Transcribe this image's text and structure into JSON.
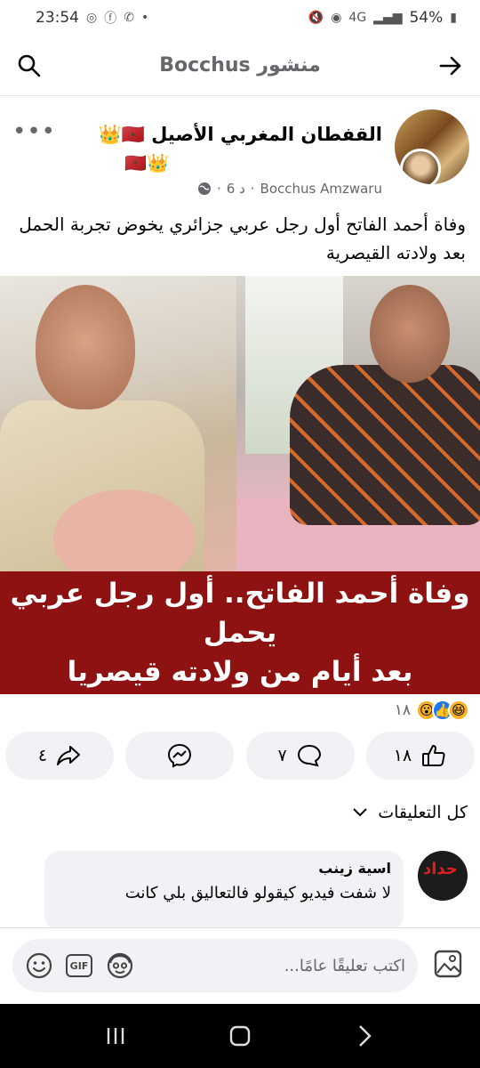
{
  "status_bar": {
    "battery": "54%",
    "time": "23:54",
    "network": "4G"
  },
  "topbar": {
    "title": "منشور Bocchus"
  },
  "post": {
    "page_name": "القفطان المغربي الأصيل",
    "flag_icons": "🇲🇦👑",
    "author": "Bocchus Amzwaru",
    "time": "6 د",
    "more_label": "•••",
    "text": "وفاة أحمد الفاتح أول رجل عربي جزائري يخوض تجربة الحمل بعد ولادته القيصرية",
    "image_caption": {
      "line1": "وفاة أحمد الفاتح.. أول رجل عربي يحمل",
      "line2": "بعد أيام من ولادته قيصريا"
    },
    "reactions": {
      "count": "١٨",
      "types": [
        "haha",
        "like",
        "wow"
      ]
    },
    "actions": {
      "like_count": "١٨",
      "comment_count": "٧",
      "share_count": "٤"
    }
  },
  "comments": {
    "filter_label": "كل التعليقات",
    "items": [
      {
        "author": "اسية زينب",
        "text": "لا شفت فيديو كيقولو فالتعاليق بلي كانت",
        "avatar_text": "حداد"
      }
    ]
  },
  "composer": {
    "placeholder": "اكتب تعليقًا عامًا...",
    "gif_label": "GIF"
  },
  "colors": {
    "caption_band": "#8e1212",
    "button_bg": "#f0f2f5",
    "secondary_text": "#65676b"
  }
}
